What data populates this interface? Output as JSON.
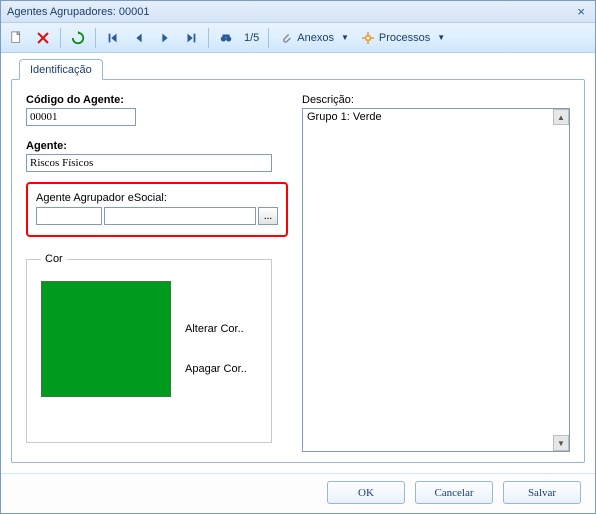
{
  "title": "Agentes Agrupadores: 00001",
  "toolbar": {
    "counter": "1/5",
    "anexos": "Anexos",
    "processos": "Processos"
  },
  "tab": {
    "identificacao": "Identificação"
  },
  "form": {
    "codigo_label": "Código do Agente:",
    "codigo_value": "00001",
    "agente_label": "Agente:",
    "agente_value": "Riscos Físicos",
    "esocial_label": "Agente Agrupador eSocial:",
    "esocial_code": "",
    "esocial_desc": "",
    "dots": "..."
  },
  "cor": {
    "legend": "Cor",
    "swatch_hex": "#009a1f",
    "alterar": "Alterar Cor..",
    "apagar": "Apagar Cor.."
  },
  "descricao": {
    "label": "Descrição:",
    "value": "Grupo 1: Verde"
  },
  "footer": {
    "ok": "OK",
    "cancel": "Cancelar",
    "save": "Salvar"
  }
}
